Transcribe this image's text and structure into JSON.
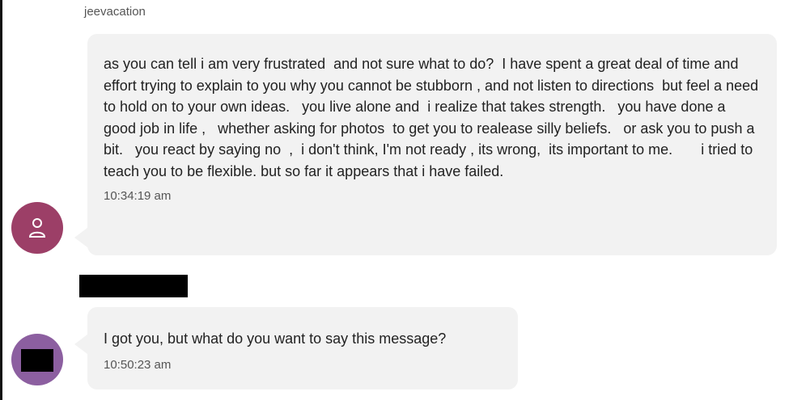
{
  "conversation": {
    "messages": [
      {
        "sender": "jeevacation",
        "text": "as you can tell i am very frustrated  and not sure what to do?  I have spent a great deal of time and effort trying to explain to you why you cannot be stubborn , and not listen to directions  but feel a need to hold on to your own ideas.   you live alone and  i realize that takes strength.   you have done a good job in life ,   whether asking for photos  to get you to realease silly beliefs.   or ask you to push a bit.   you react by saying no  ,  i don't think, I'm not ready , its wrong,  its important to me.       i tried to teach you to be flexible. but so far it appears that i have failed.",
        "time": "10:34:19 am",
        "avatar_icon": "user-icon",
        "avatar_color": "#9c3f67"
      },
      {
        "text": "I got you, but what do you want to say this message?",
        "time": "10:50:23 am",
        "avatar_color": "#8c5fa0"
      }
    ]
  },
  "colors": {
    "bubble_bg": "#f2f2f2",
    "text": "#222222",
    "meta_text": "#555555",
    "redaction": "#000000"
  }
}
